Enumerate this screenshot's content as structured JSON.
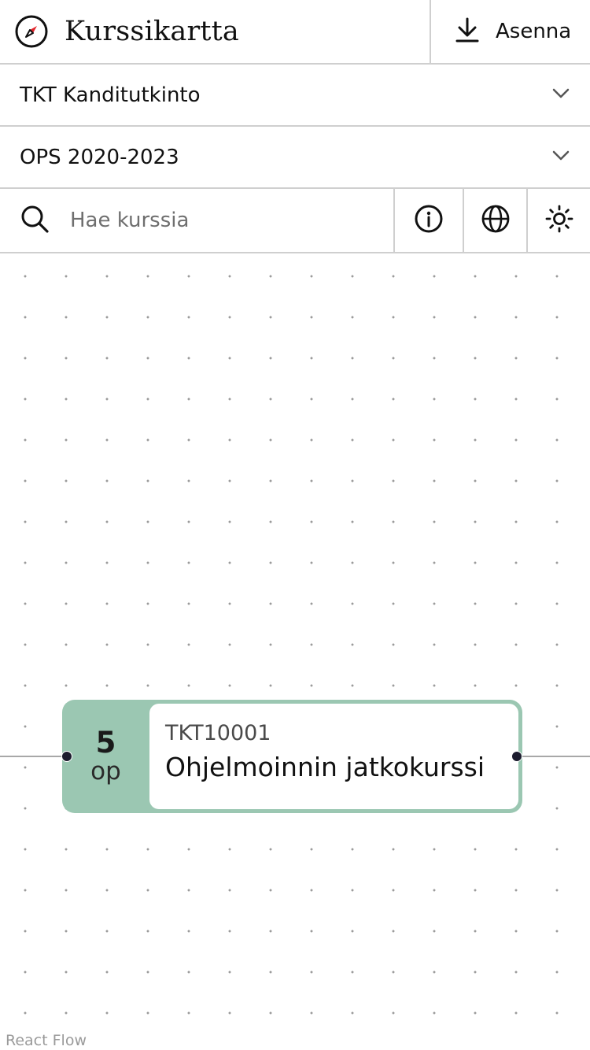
{
  "header": {
    "app_title": "Kurssikartta",
    "logo_icon": "compass-icon",
    "install_label": "Asenna",
    "install_icon": "download-icon"
  },
  "selectors": {
    "degree": {
      "value": "TKT Kanditutkinto",
      "icon": "chevron-down-icon"
    },
    "curriculum": {
      "value": "OPS 2020-2023",
      "icon": "chevron-down-icon"
    }
  },
  "search": {
    "placeholder": "Hae kurssia",
    "icon": "search-icon"
  },
  "toolbar": {
    "info_icon": "info-icon",
    "language_icon": "globe-icon",
    "theme_icon": "sun-icon"
  },
  "course_node": {
    "credits": "5",
    "credits_unit": "op",
    "code": "TKT10001",
    "name": "Ohjelmoinnin jatkokurssi",
    "accent_color": "#9bc7b2"
  },
  "canvas": {
    "attribution": "React Flow"
  }
}
